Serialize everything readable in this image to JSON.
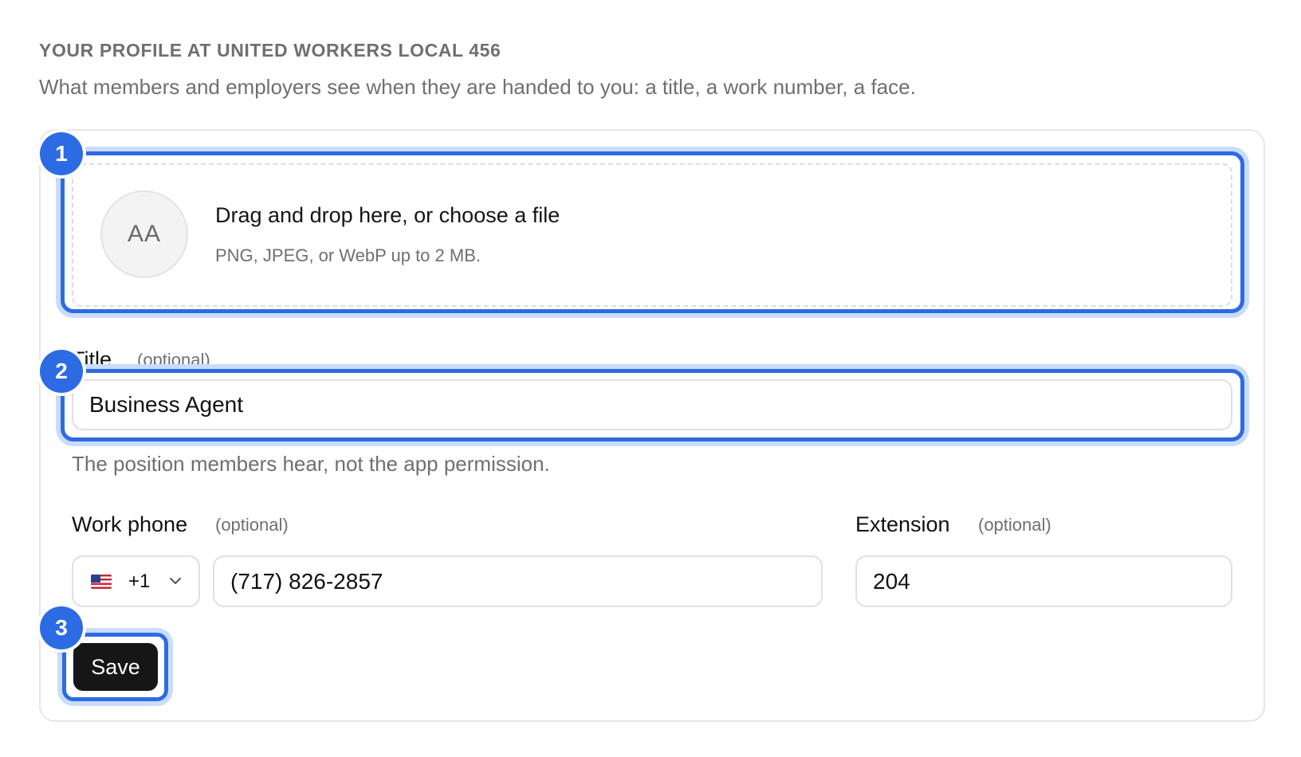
{
  "section": {
    "title": "YOUR PROFILE AT UNITED WORKERS LOCAL 456",
    "description": "What members and employers see when they are handed to you: a title, a work number, a face."
  },
  "photo_upload": {
    "initials": "AA",
    "prompt": "Drag and drop here, or choose a file",
    "hint": "PNG, JPEG, or WebP up to 2 MB."
  },
  "title_field": {
    "label": "Title",
    "optional": "(optional)",
    "value": "Business Agent",
    "helper": "The position members hear, not the app permission."
  },
  "work_phone": {
    "label": "Work phone",
    "optional": "(optional)",
    "country_icon": "us-flag-icon",
    "dial_code": "+1",
    "value": "(717) 826-2857"
  },
  "extension": {
    "label": "Extension",
    "optional": "(optional)",
    "value": "204"
  },
  "actions": {
    "save_label": "Save"
  },
  "annotations": {
    "markers": [
      "1",
      "2",
      "3"
    ],
    "accent": "#2d6be4"
  }
}
